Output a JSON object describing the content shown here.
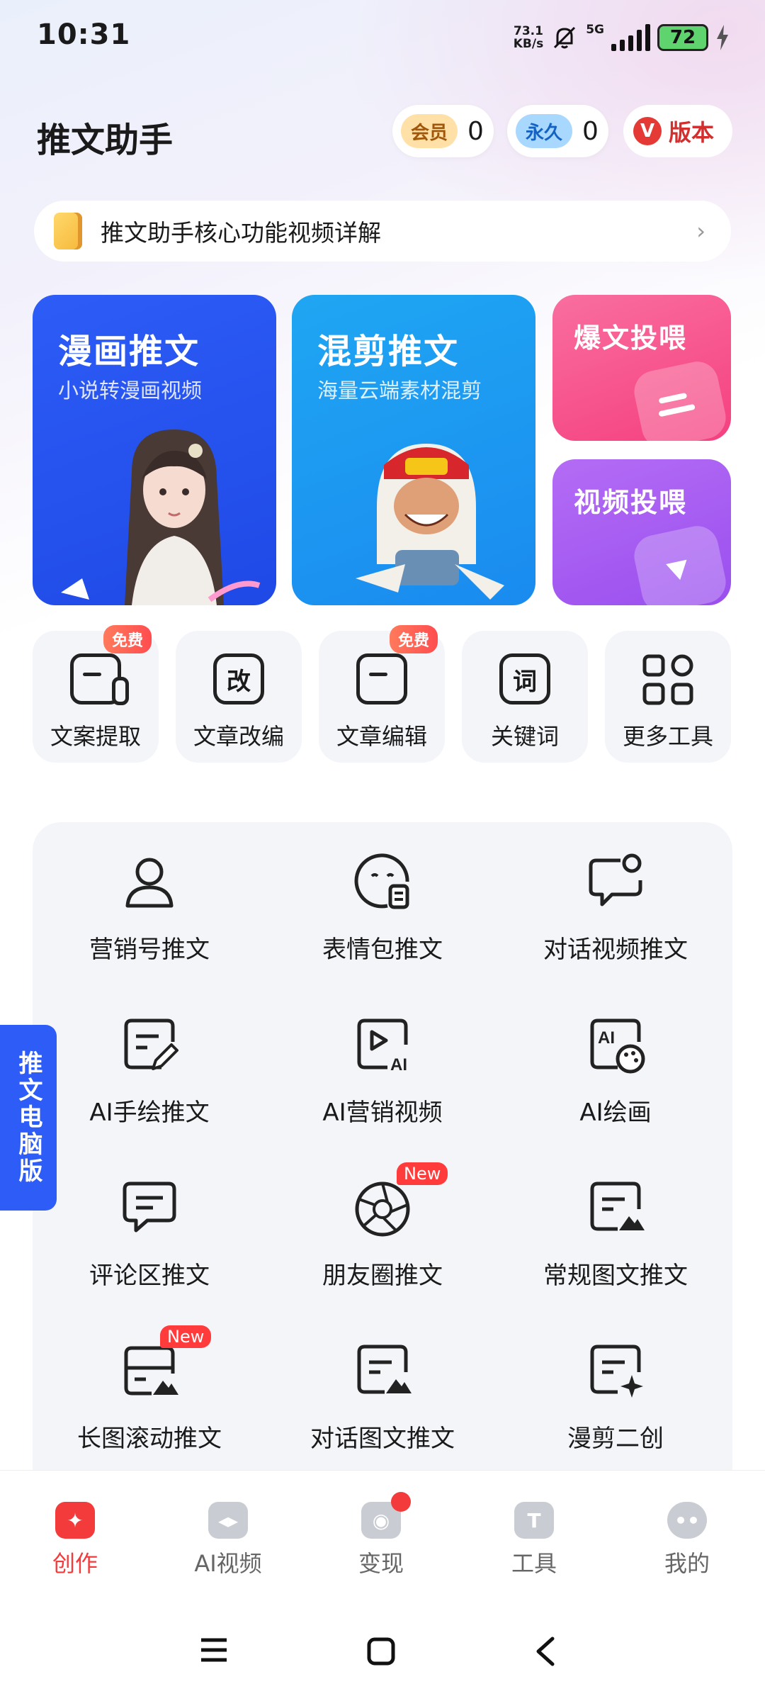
{
  "status_bar": {
    "time": "10:31",
    "net_speed_value": "73.1",
    "net_speed_unit": "KB/s",
    "signal": "5G",
    "battery": "72"
  },
  "header": {
    "title": "推文助手",
    "member_label": "会员",
    "member_count": "0",
    "forever_label": "永久",
    "forever_count": "0",
    "version_icon": "V",
    "version_label": "版本"
  },
  "notice": {
    "text": "推文助手核心功能视频详解"
  },
  "cards": [
    {
      "title": "漫画推文",
      "subtitle": "小说转漫画视频"
    },
    {
      "title": "混剪推文",
      "subtitle": "海量云端素材混剪"
    },
    {
      "title": "爆文投喂"
    },
    {
      "title": "视频投喂"
    }
  ],
  "tools": [
    {
      "label": "文案提取",
      "badge": "免费",
      "icon": "document-icon"
    },
    {
      "label": "文章改编",
      "glyph": "改",
      "icon": "rewrite-icon"
    },
    {
      "label": "文章编辑",
      "badge": "免费",
      "icon": "edit-doc-icon"
    },
    {
      "label": "关键词",
      "glyph": "词",
      "icon": "keyword-icon"
    },
    {
      "label": "更多工具",
      "icon": "grid-icon"
    }
  ],
  "grid": [
    {
      "label": "营销号推文",
      "icon": "person-icon"
    },
    {
      "label": "表情包推文",
      "icon": "emoji-icon"
    },
    {
      "label": "对话视频推文",
      "icon": "chat-bubble-icon"
    },
    {
      "label": "AI手绘推文",
      "icon": "pen-doc-icon"
    },
    {
      "label": "AI营销视频",
      "icon": "ai-video-icon"
    },
    {
      "label": "AI绘画",
      "icon": "ai-palette-icon"
    },
    {
      "label": "评论区推文",
      "icon": "comment-icon"
    },
    {
      "label": "朋友圈推文",
      "icon": "aperture-icon",
      "badge": "New"
    },
    {
      "label": "常规图文推文",
      "icon": "image-doc-icon"
    },
    {
      "label": "长图滚动推文",
      "icon": "long-image-icon",
      "badge": "New"
    },
    {
      "label": "对话图文推文",
      "icon": "dialog-image-icon"
    },
    {
      "label": "漫剪二创",
      "icon": "sparkle-doc-icon"
    }
  ],
  "side_tab": {
    "label": "推文电脑版"
  },
  "bottom_nav": [
    {
      "label": "创作",
      "icon": "create-icon",
      "active": true
    },
    {
      "label": "AI视频",
      "icon": "ai-video-nav-icon"
    },
    {
      "label": "变现",
      "icon": "monetize-icon",
      "dot": true
    },
    {
      "label": "工具",
      "icon": "tools-icon"
    },
    {
      "label": "我的",
      "icon": "profile-icon"
    }
  ],
  "colors": {
    "accent_red": "#f33b3b",
    "card_blue": "#2d5cf6",
    "card_cyan": "#1fa6f2",
    "card_pink": "#f54b8d",
    "card_purple": "#a35af0",
    "side_tab_blue": "#2d5cf6"
  }
}
